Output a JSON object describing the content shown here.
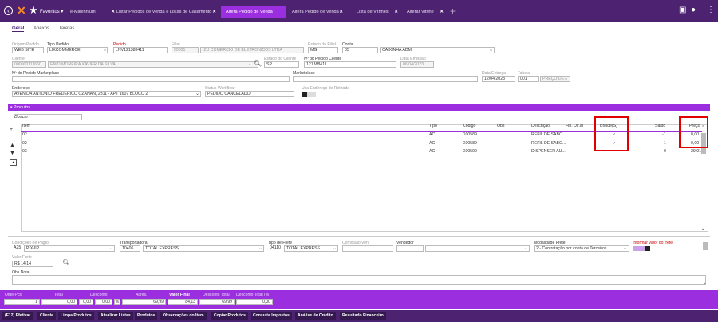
{
  "tabs": [
    {
      "label": "Favoritos",
      "dropdown": "▾"
    },
    {
      "label": "e-Millennium"
    },
    {
      "label": "Listar Pedidos de Venda e Listas de Casamento"
    },
    {
      "label": "Altera Pedido de Venda"
    },
    {
      "label": "Altera Pedido de Venda"
    },
    {
      "label": "Lista de Vitrines"
    },
    {
      "label": "Alterar Vitrine"
    }
  ],
  "subtabs": [
    "Geral",
    "Anexos",
    "Tarefas"
  ],
  "form": {
    "origem_label": "Origem Pedido",
    "origem": "WEB SITE",
    "tipo_label": "Tipo Pedido",
    "tipo": "LIKCOMMERCE",
    "pedido_label": "Pedido",
    "pedido": "LNV121388411",
    "filial_label": "Filial",
    "filial_code": "00001",
    "filial_name": "IZU COMERCIO DE ELETRONICOS LTDA",
    "estado_filial_label": "Estado da Filial",
    "estado_filial": "MG",
    "conta_label": "Conta",
    "conta_code": "05",
    "conta_name": "CAIXINHA ADM",
    "cliente_label": "Cliente",
    "cliente_code": "000000111660",
    "cliente_name": "ENIO MOREIRA XAVIER DA SILVA",
    "estado_cliente_label": "Estado do Cliente",
    "estado_cliente": "SP",
    "npc_label": "Nº do Pedido Cliente",
    "npc": "121388411",
    "data_emissao_label": "Data Emissão",
    "data_emissao": "06/04/2023",
    "marketplace_pedido_label": "Nº do Pedido Marketplace",
    "marketplace_label": "Marketplace",
    "data_entrega_label": "Data Entrega",
    "data_entrega": "12/04/2023",
    "tabela_label": "Tabela",
    "tabela_code": "001",
    "tabela_name": "PREÇO DE",
    "endereco_label": "Endereço",
    "endereco": "AVENIDA ANTÔNIO FREDERICO OZANAN, 2311 - APT 1607 BLOCO 2",
    "status_label": "Status Workflow",
    "status": "PEDIDO CANCELADO",
    "retirada_label": "Usa Endereço de Retirada"
  },
  "produtos": {
    "title": "Produtos",
    "buscar_label": "Buscar",
    "columns": [
      "Item",
      "Tipo",
      "Código",
      "Obs",
      "Descrição",
      "Fin. Dif.al",
      "Brinde(S)",
      "Saldo",
      "Preço"
    ],
    "rows": [
      {
        "item": "02",
        "tipo": "AC",
        "codigo": "X00589",
        "obs": "",
        "descricao": "REFIL DE SABO...",
        "brinde": "✓",
        "saldo": "-1",
        "preco": "0,00"
      },
      {
        "item": "02",
        "tipo": "AC",
        "codigo": "X00589",
        "obs": "",
        "descricao": "REFIL DE SABO...",
        "brinde": "✓",
        "saldo": "1",
        "preco": "0,00"
      },
      {
        "item": "03",
        "tipo": "AC",
        "codigo": "X00590",
        "obs": "",
        "descricao": "DISPENSER AU...",
        "brinde": "",
        "saldo": "0",
        "preco": "29,01"
      }
    ]
  },
  "bottomform": {
    "cond_label": "Condições de Pagto",
    "cond_code": "A25",
    "cond_name": "PIX/IIP",
    "transp_label": "Transportadora",
    "transp_code": "10406",
    "transp_name": "TOTAL EXPRESS",
    "frete_label": "Tipo de Frete",
    "frete_code": "04110",
    "frete_name": "TOTAL EXPRESS",
    "comissao_label": "Comissao Ven.",
    "vendedor_label": "Vendedor",
    "modalidade_label": "Modalidade Frete",
    "modalidade": "2 - Contratação por conta de Terceiros",
    "informar_label": "Informar valor do frete",
    "valor_frete_label": "Valor Frete",
    "valor_frete": "R$ 14,14",
    "obs_label": "Obs Nota:"
  },
  "totals": {
    "qtde_label": "Qtde Pcs",
    "qtde": "1",
    "total_label": "Total",
    "total": "0,00",
    "desconto_label": "Desconto",
    "desc1": "0,00",
    "desc2": "0,00",
    "acres_label": "Acrés.",
    "acres": "69,99",
    "valor_final_label": "Valor Final",
    "valor_final": "84,13",
    "desc_total_label": "Desconto Total",
    "desc_total": "69,99",
    "desc_total_pct_label": "Desconto Total (%)",
    "desc_total_pct": "0,00"
  },
  "actions": [
    "(F12) Efetivar",
    "Cliente",
    "Limpa Produtos",
    "Atualizar Listas",
    "Produtos",
    "Observações do Item",
    "Copiar Produtos",
    "Consulta Impostos",
    "Análise de Crédito",
    "Resultado Financeiro"
  ],
  "colors": {
    "purple_dark": "#4d2270",
    "purple": "#9b2fe0",
    "highlight": "#e00000"
  }
}
